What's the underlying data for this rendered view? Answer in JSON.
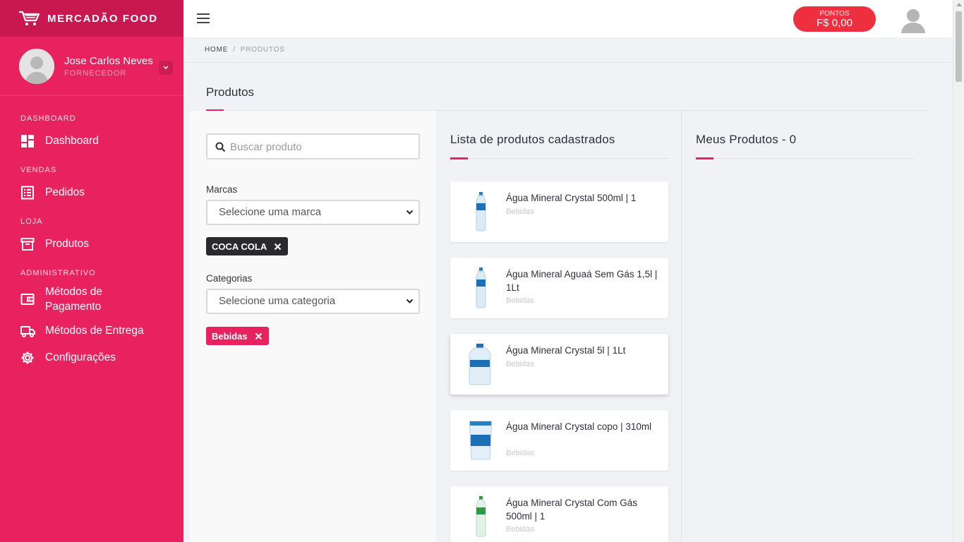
{
  "brand": {
    "name": "MERCADÃO FOOD"
  },
  "user": {
    "name": "Jose Carlos Neves",
    "role": "FORNECEDOR"
  },
  "nav": {
    "sections": [
      {
        "label": "DASHBOARD",
        "items": [
          {
            "label": "Dashboard",
            "icon": "dashboard-icon"
          }
        ]
      },
      {
        "label": "VENDAS",
        "items": [
          {
            "label": "Pedidos",
            "icon": "orders-icon"
          }
        ]
      },
      {
        "label": "LOJA",
        "items": [
          {
            "label": "Produtos",
            "icon": "box-icon"
          }
        ]
      },
      {
        "label": "ADMINISTRATIVO",
        "items": [
          {
            "label": "Métodos de Pagamento",
            "icon": "wallet-icon"
          },
          {
            "label": "Métodos de Entrega",
            "icon": "truck-icon"
          },
          {
            "label": "Configurações",
            "icon": "gear-icon"
          }
        ]
      }
    ]
  },
  "topbar": {
    "points_label": "PONTOS",
    "points_value": "F$ 0,00"
  },
  "breadcrumb": {
    "home": "HOME",
    "separator": "/",
    "current": "PRODUTOS"
  },
  "page": {
    "title": "Produtos"
  },
  "filters": {
    "search_placeholder": "Buscar produto",
    "brands_label": "Marcas",
    "brands_select": "Selecione uma marca",
    "brand_chip": "COCA COLA",
    "categories_label": "Categorias",
    "categories_select": "Selecione uma categoria",
    "category_chip": "Bebidas"
  },
  "product_list": {
    "title": "Lista de produtos cadastrados",
    "items": [
      {
        "name": "Água Mineral Crystal 500ml | 1",
        "category": "Bebidas"
      },
      {
        "name": "Água Mineral Aguaá Sem Gás 1,5l | 1Lt",
        "category": "Bebidas"
      },
      {
        "name": "Água Mineral Crystal 5l | 1Lt",
        "category": "Bebidas"
      },
      {
        "name": "Água Mineral Crystal copo | 310ml",
        "category": "Bebidas"
      },
      {
        "name": "Água Mineral Crystal Com Gás 500ml | 1",
        "category": "Bebidas"
      }
    ]
  },
  "my_products": {
    "title": "Meus Produtos - 0"
  },
  "colors": {
    "primary": "#e8225f",
    "brand_dark": "#c8184f",
    "points": "#ee2f40"
  }
}
